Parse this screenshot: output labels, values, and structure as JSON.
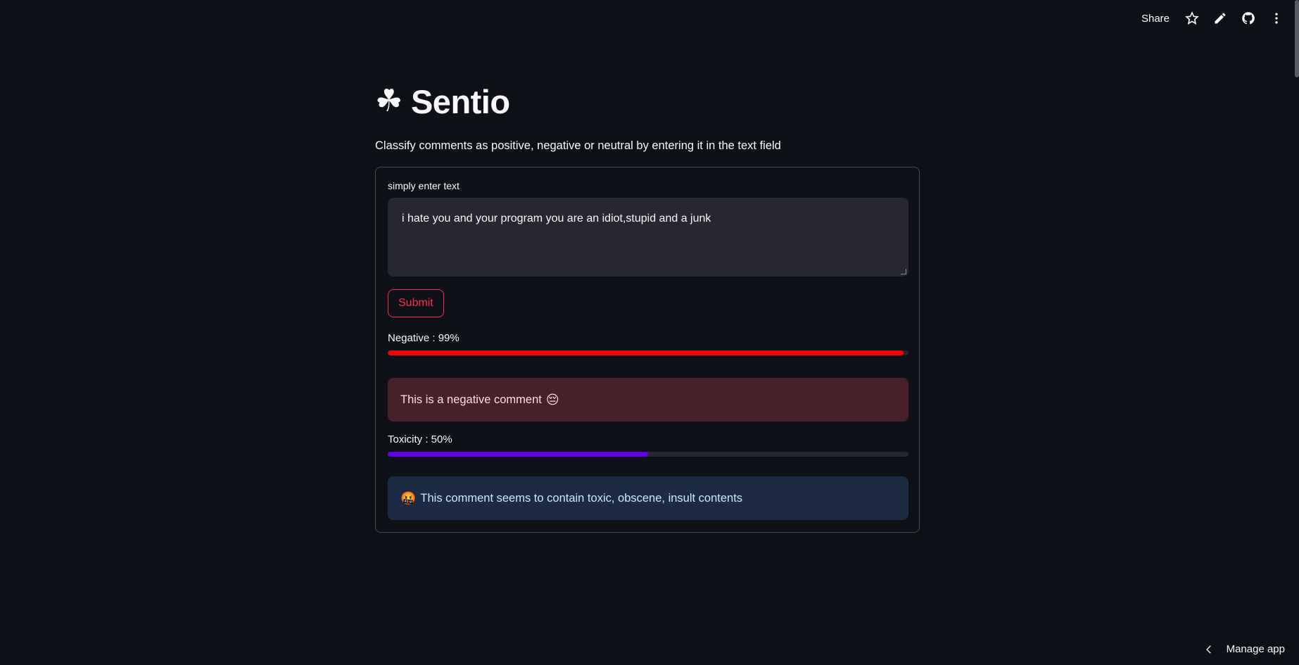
{
  "toolbar": {
    "share_label": "Share",
    "icons": [
      "star-icon",
      "pencil-icon",
      "github-icon",
      "more-vertical-icon"
    ]
  },
  "header": {
    "icon": "☘",
    "title": "Sentio",
    "subtitle": "Classify comments as positive, negative or neutral by entering it in the text field"
  },
  "form": {
    "field_label": "simply enter text",
    "textarea_value": "i hate you and your program you are an idiot,stupid and a junk",
    "submit_label": "Submit"
  },
  "results": {
    "negative_label": "Negative : 99%",
    "negative_value": 0.99,
    "negative_color": "#ff0000",
    "negative_alert": "This is a negative comment",
    "negative_alert_emoji": "😔",
    "toxicity_label": "Toxicity : 50%",
    "toxicity_value": 0.5,
    "toxicity_color": "#6200ea",
    "toxicity_alert_emoji": "🤬",
    "toxicity_alert": "This comment seems to contain toxic, obscene, insult contents"
  },
  "footer": {
    "manage_label": "Manage app"
  }
}
